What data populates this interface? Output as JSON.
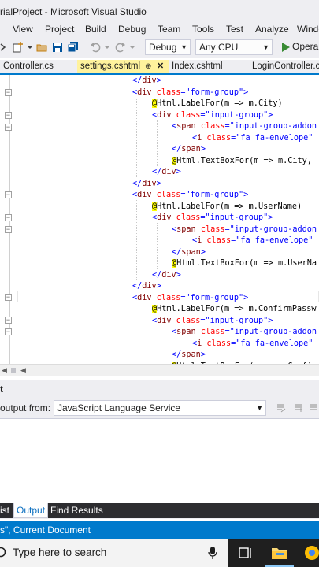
{
  "window": {
    "title": "rialProject - Microsoft Visual Studio"
  },
  "menu": [
    "View",
    "Project",
    "Build",
    "Debug",
    "Team",
    "Tools",
    "Test",
    "Analyze",
    "Windo"
  ],
  "toolbar": {
    "config_value": "Debug",
    "platform_value": "Any CPU",
    "run_label": "Opera"
  },
  "tabs": [
    {
      "label": "Controller.cs",
      "active": false
    },
    {
      "label": "settings.cshtml",
      "active": true
    },
    {
      "label": "Index.cshtml",
      "active": false
    },
    {
      "label": "LoginController.cs",
      "active": false
    }
  ],
  "code": [
    [
      "</div>"
    ],
    [
      "<div class=\"form-group\">"
    ],
    [
      "@Html.LabelFor(m => m.City)"
    ],
    [
      "<div class=\"input-group\">"
    ],
    [
      "<span class=\"input-group-addon"
    ],
    [
      "<i class=\"fa fa-envelope\""
    ],
    [
      "</span>"
    ],
    [
      "@Html.TextBoxFor(m => m.City,"
    ],
    [
      "</div>"
    ],
    [
      "</div>"
    ],
    [
      "<div class=\"form-group\">"
    ],
    [
      "@Html.LabelFor(m => m.UserName)"
    ],
    [
      "<div class=\"input-group\">"
    ],
    [
      "<span class=\"input-group-addon"
    ],
    [
      "<i class=\"fa fa-envelope\""
    ],
    [
      "</span>"
    ],
    [
      "@Html.TextBoxFor(m => m.UserNa"
    ],
    [
      "</div>"
    ],
    [
      "</div>"
    ],
    [
      "<div class=\"form-group\">"
    ],
    [
      "@Html.LabelFor(m => m.ConfirmPassw"
    ],
    [
      "<div class=\"input-group\">"
    ],
    [
      "<span class=\"input-group-addon"
    ],
    [
      "<i class=\"fa fa-envelope\""
    ],
    [
      "</span>"
    ],
    [
      "@Html.TextBoxFor(m => m.Confir"
    ]
  ],
  "output": {
    "header": "t",
    "show_output_from_label": "output from:",
    "source_value": "JavaScript Language Service"
  },
  "bottom_tabs": [
    {
      "label": "ist",
      "active": false
    },
    {
      "label": "Output",
      "active": true
    },
    {
      "label": "Find Results 1",
      "active": false
    }
  ],
  "status": {
    "text": "s\", Current Document"
  },
  "taskbar": {
    "search_placeholder": "Type here to search"
  },
  "colors": {
    "accent": "#007acc",
    "active_tab": "#fff29d",
    "html_tag": "#800000",
    "html_attr": "#ff0000",
    "html_value": "#0000ff",
    "razor_marker": "#ffff00"
  }
}
